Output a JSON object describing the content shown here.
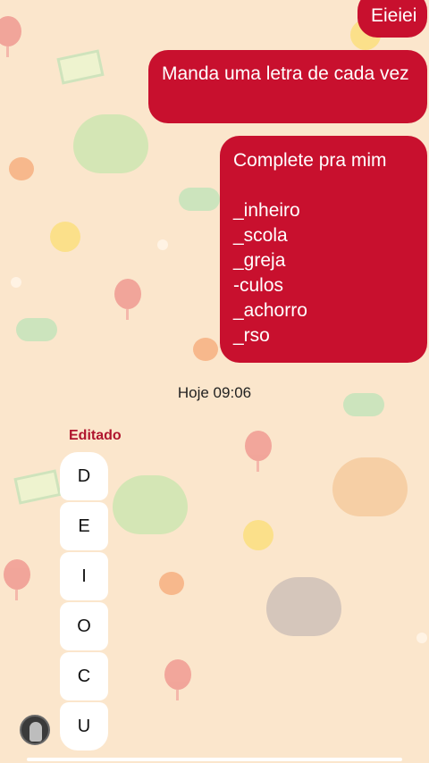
{
  "messages_sent": [
    {
      "text": "Eieiei"
    },
    {
      "text": "Manda uma letra de cada vez"
    },
    {
      "title": "Complete pra mim",
      "lines": "_inheiro\n_scola\n_greja\n-culos\n_achorro\n_rso"
    }
  ],
  "timestamp": "Hoje 09:06",
  "received": {
    "edited_label": "Editado",
    "letters": [
      "D",
      "E",
      "I",
      "O",
      "C",
      "U"
    ]
  },
  "colors": {
    "sent_bubble": "#c8102e",
    "background": "#fbe6cc",
    "edited_label": "#b0152e"
  }
}
